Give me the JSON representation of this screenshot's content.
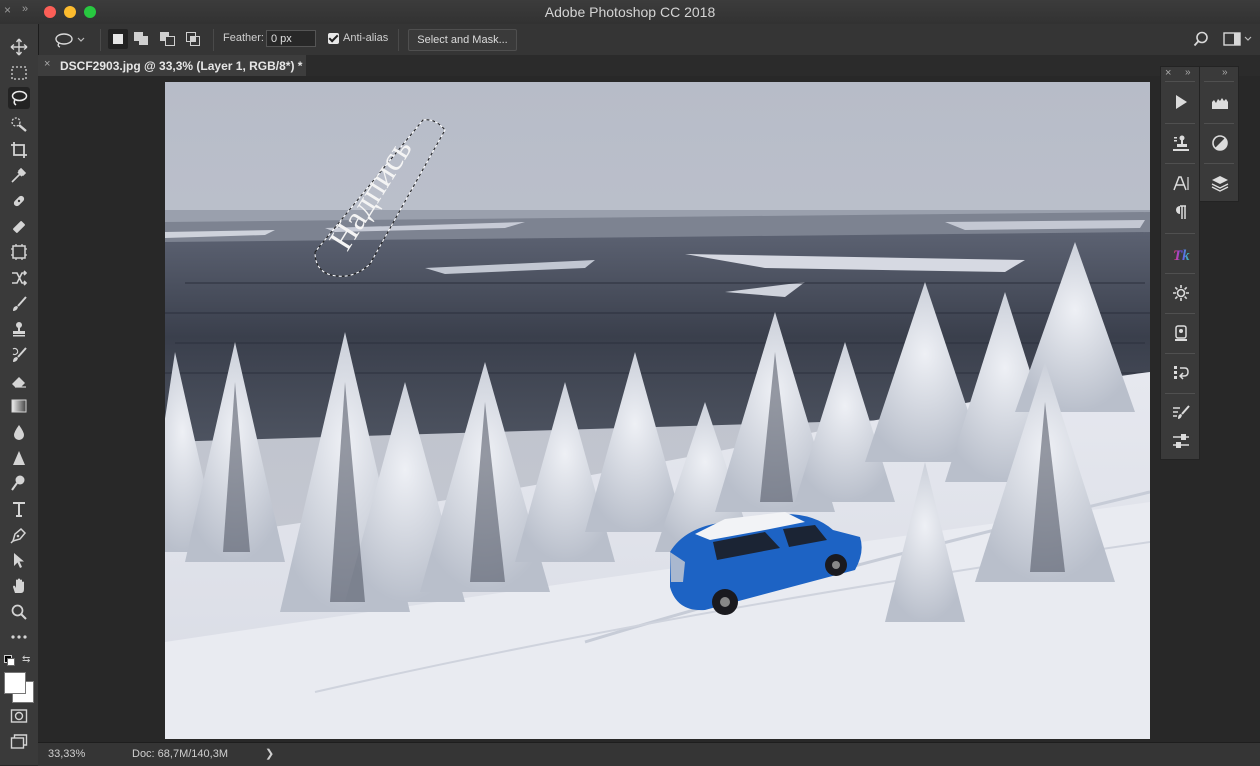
{
  "window": {
    "title": "Adobe Photoshop CC 2018",
    "close_glyph": "×",
    "collapse_glyph": "»"
  },
  "options_bar": {
    "tool_icon": "lasso-icon",
    "feather_label": "Feather:",
    "feather_value": "0 px",
    "anti_alias_label": "Anti-alias",
    "anti_alias_checked": true,
    "select_and_mask_label": "Select and Mask..."
  },
  "document": {
    "tab_close_glyph": "×",
    "tab_title": "DSCF2903.jpg @ 33,3% (Layer 1, RGB/8*) *",
    "overlay_text": "Надпись"
  },
  "toolbar": {
    "tools": [
      "move-icon",
      "marquee-icon",
      "lasso-icon",
      "quick-selection-icon",
      "crop-icon",
      "eyedropper-icon",
      "healing-brush-icon",
      "patch-icon",
      "frame-icon",
      "content-aware-move-icon",
      "brush-icon",
      "clone-stamp-icon",
      "history-brush-icon",
      "eraser-icon",
      "gradient-icon",
      "blur-icon",
      "sharpen-icon",
      "dodge-icon",
      "type-icon",
      "pen-icon",
      "path-selection-icon",
      "hand-icon",
      "zoom-icon",
      "more-tools-icon"
    ],
    "active_tool": "lasso-icon",
    "foreground_color": "#ffffff",
    "background_color": "#ffffff"
  },
  "right_panels": {
    "collapse_glyph": "»",
    "close_glyph": "×",
    "column1": [
      "play-actions-icon",
      "clone-source-icon",
      "character-icon",
      "paragraph-icon",
      "tk-plugin-icon",
      "settings-gear-icon",
      "device-preview-icon",
      "history-icon",
      "brush-settings-icon",
      "tool-presets-icon"
    ],
    "column2": [
      "histogram-icon",
      "adjustments-icon",
      "layers-icon"
    ]
  },
  "status_bar": {
    "zoom": "33,33%",
    "doc_size": "Doc: 68,7M/140,3M",
    "arrow": "❯"
  }
}
